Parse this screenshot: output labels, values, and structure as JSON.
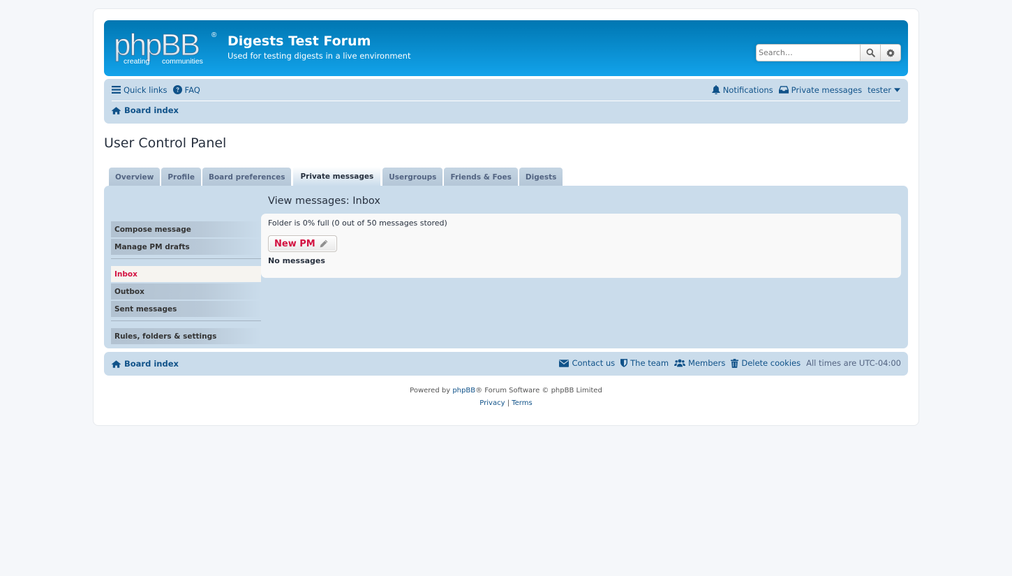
{
  "header": {
    "logo_text": "phpBB",
    "logo_tagline_left": "creating",
    "logo_tagline_right": "communities",
    "site_title": "Digests Test Forum",
    "site_description": "Used for testing digests in a live environment",
    "search_placeholder": "Search…",
    "search_button_icon": "search-icon",
    "advanced_search_icon": "gear-icon"
  },
  "navbar": {
    "quick_links": "Quick links",
    "faq": "FAQ",
    "notifications": "Notifications",
    "private_messages": "Private messages",
    "username": "tester",
    "breadcrumb": "Board index"
  },
  "page": {
    "title": "User Control Panel"
  },
  "tabs": [
    {
      "label": "Overview",
      "active": false
    },
    {
      "label": "Profile",
      "active": false
    },
    {
      "label": "Board preferences",
      "active": false
    },
    {
      "label": "Private messages",
      "active": true
    },
    {
      "label": "Usergroups",
      "active": false
    },
    {
      "label": "Friends & Foes",
      "active": false
    },
    {
      "label": "Digests",
      "active": false
    }
  ],
  "side_menu": {
    "group1": [
      {
        "label": "Compose message"
      },
      {
        "label": "Manage PM drafts"
      }
    ],
    "group2": [
      {
        "label": "Inbox",
        "active": true
      },
      {
        "label": "Outbox"
      },
      {
        "label": "Sent messages"
      }
    ],
    "group3": [
      {
        "label": "Rules, folders & settings"
      }
    ]
  },
  "content": {
    "title": "View messages: Inbox",
    "folder_status": "Folder is 0% full (0 out of 50 messages stored)",
    "folder_percent_full": 0,
    "messages_stored": 0,
    "messages_capacity": 50,
    "new_pm_label": "New PM",
    "empty_text": "No messages"
  },
  "footer": {
    "breadcrumb": "Board index",
    "contact_us": "Contact us",
    "the_team": "The team",
    "members": "Members",
    "delete_cookies": "Delete cookies",
    "timezone": "All times are UTC-04:00",
    "powered_by_prefix": "Powered by ",
    "powered_by_link": "phpBB",
    "powered_by_suffix": "® Forum Software © phpBB Limited",
    "privacy": "Privacy",
    "separator": " | ",
    "terms": "Terms"
  },
  "colors": {
    "header_gradient_top": "#0076b1",
    "header_gradient_bottom": "#12a3eb",
    "navbar_bg": "#cadceb",
    "link": "#105289",
    "active_red": "#d31141",
    "page_bg": "#f5f7fa"
  }
}
